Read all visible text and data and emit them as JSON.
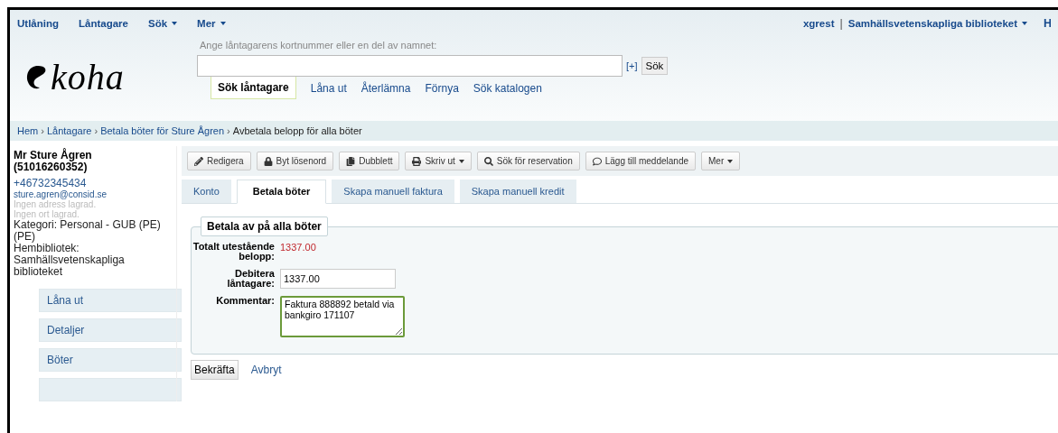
{
  "top_nav": {
    "items": [
      {
        "label": "Utlåning",
        "dropdown": false
      },
      {
        "label": "Låntagare",
        "dropdown": false
      },
      {
        "label": "Sök",
        "dropdown": true
      },
      {
        "label": "Mer",
        "dropdown": true
      }
    ],
    "user": "xgrest",
    "separator": "|",
    "library": "Samhällsvetenskapliga biblioteket",
    "cut_item": "H"
  },
  "logo": {
    "text": "koha"
  },
  "search": {
    "hint": "Ange låntagarens kortnummer eller en del av namnet:",
    "expand": "[+]",
    "button": "Sök"
  },
  "search_tabs": [
    {
      "label": "Sök låntagare",
      "selected": true
    },
    {
      "label": "Låna ut",
      "selected": false
    },
    {
      "label": "Återlämna",
      "selected": false
    },
    {
      "label": "Förnya",
      "selected": false
    },
    {
      "label": "Sök katalogen",
      "selected": false
    }
  ],
  "breadcrumb": {
    "separator": "›",
    "links": [
      "Hem",
      "Låntagare",
      "Betala böter för Sture Ågren"
    ],
    "current": "Avbetala belopp för alla böter"
  },
  "patron": {
    "name": "Mr Sture Ågren (51016260352)",
    "phone": "+46732345434",
    "email": "sture.agren@consid.se",
    "address": "Ingen adress lagrad.",
    "city": "Ingen ort lagrad.",
    "category": "Kategori: Personal - GUB (PE) (PE)",
    "home_library": "Hembibliotek: Samhällsvetenskapliga biblioteket"
  },
  "sidebar_menu": {
    "items": [
      "Låna ut",
      "Detaljer",
      "Böter"
    ]
  },
  "toolbar": {
    "buttons": [
      {
        "label": "Redigera",
        "dropdown": false
      },
      {
        "label": "Byt lösenord",
        "dropdown": false
      },
      {
        "label": "Dubblett",
        "dropdown": false
      },
      {
        "label": "Skriv ut",
        "dropdown": true
      },
      {
        "label": "Sök för reservation",
        "dropdown": false
      },
      {
        "label": "Lägg till meddelande",
        "dropdown": false
      },
      {
        "label": "Mer",
        "dropdown": true
      }
    ]
  },
  "tabs": [
    {
      "label": "Konto",
      "selected": false
    },
    {
      "label": "Betala böter",
      "selected": true
    },
    {
      "label": "Skapa manuell faktura",
      "selected": false
    },
    {
      "label": "Skapa manuell kredit",
      "selected": false
    }
  ],
  "form": {
    "legend": "Betala av på alla böter",
    "fields": [
      {
        "kind": "amount",
        "label": "Totalt utestående belopp:",
        "value": "1337.00"
      },
      {
        "kind": "input",
        "label": "Debitera låntagare:",
        "value": "1337.00"
      },
      {
        "kind": "textarea",
        "label": "Kommentar:",
        "value": "Faktura 888892 betald via bankgiro 171107"
      }
    ]
  },
  "actions": {
    "confirm": "Bekräfta",
    "cancel": "Avbryt"
  }
}
